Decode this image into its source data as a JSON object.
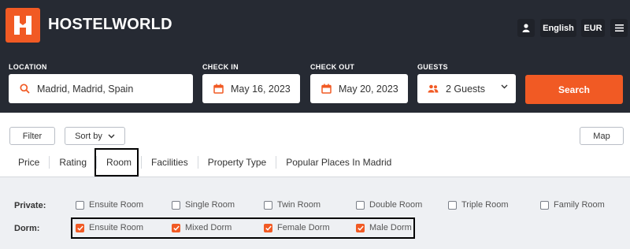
{
  "brand": {
    "name": "HOSTELWORLD",
    "accent": "#f15a24",
    "header_bg": "#262a33"
  },
  "topnav": {
    "language": "English",
    "currency": "EUR",
    "user_icon": "user-icon",
    "menu_icon": "hamburger-icon"
  },
  "search": {
    "location_label": "LOCATION",
    "location_value": "Madrid, Madrid, Spain",
    "checkin_label": "CHECK IN",
    "checkin_value": "May 16, 2023",
    "checkout_label": "CHECK OUT",
    "checkout_value": "May 20, 2023",
    "guests_label": "GUESTS",
    "guests_value": "2 Guests",
    "button": "Search"
  },
  "toolbar": {
    "filter": "Filter",
    "sort": "Sort by",
    "map": "Map"
  },
  "tabs": [
    "Price",
    "Rating",
    "Room",
    "Facilities",
    "Property Type",
    "Popular Places In Madrid"
  ],
  "room_filters": {
    "private_label": "Private:",
    "private": [
      {
        "label": "Ensuite Room",
        "checked": false
      },
      {
        "label": "Single Room",
        "checked": false
      },
      {
        "label": "Twin Room",
        "checked": false
      },
      {
        "label": "Double Room",
        "checked": false
      },
      {
        "label": "Triple Room",
        "checked": false
      },
      {
        "label": "Family Room",
        "checked": false
      }
    ],
    "dorm_label": "Dorm:",
    "dorm": [
      {
        "label": "Ensuite Room",
        "checked": true
      },
      {
        "label": "Mixed Dorm",
        "checked": true
      },
      {
        "label": "Female Dorm",
        "checked": true
      },
      {
        "label": "Male Dorm",
        "checked": true
      }
    ]
  }
}
